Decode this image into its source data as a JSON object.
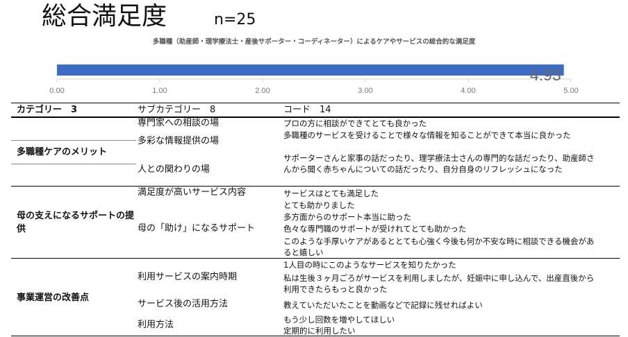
{
  "header": {
    "title": "総合満足度",
    "n_label": "n=25",
    "subtitle": "多職種（助産師・理学療法士・産後サポーター・コーディネーター）によるケアやサービスの総合的な満足度"
  },
  "colors": {
    "bar": "#3c6cc8",
    "value_label": "#666666"
  },
  "chart_data": {
    "type": "bar",
    "orientation": "horizontal",
    "categories": [
      ""
    ],
    "values": [
      4.93
    ],
    "value_labels": [
      "4.93"
    ],
    "xlim": [
      0,
      5
    ],
    "xticks": [
      "0.00",
      "1.00",
      "2.00",
      "3.00",
      "4.00",
      "5.00"
    ],
    "grid": false,
    "legend": "none"
  },
  "table": {
    "headers": {
      "category": "カテゴリー　3",
      "subcategory": "サブカテゴリー　8",
      "code": "コード　14"
    },
    "sections": [
      {
        "category": "多職種ケアのメリット",
        "subcategories": [
          "専門家への相談の場",
          "多彩な情報提供の場",
          "人との関わりの場"
        ],
        "codes": [
          "プロの方に相談ができてとても良かった",
          "多職種のサービスを受けることで様々な情報を知ることができて本当に良かった",
          "サポーターさんと家事の話だったり、理学療法士さんの専門的な話だったり、助産師さんから聞く赤ちゃんについての話だったり、自分自身のリフレッシュになった"
        ]
      },
      {
        "category": "母の支えになるサポートの提供",
        "subcategories": [
          "満足度が高いサービス内容",
          "母の「助け」になるサポート"
        ],
        "codes": [
          "サービスはとても満足した",
          "とても助かりました",
          "多方面からのサポート本当に助った",
          "色々な専門職のサポートが受けれてとても助かった",
          "このような手厚いケアがあるととても心強く今後も何か不安な時に相談できる機会があると嬉しい"
        ]
      },
      {
        "category": "事業運営の改善点",
        "subcategories": [
          "利用サービスの案内時期",
          "サービス後の活用方法",
          "利用方法"
        ],
        "codes": [
          "1人目の時にこのようなサービスを知りたかった",
          "私は生後３ヶ月ごろがサービスを利用しましたが、妊娠中に申し込んで、出産直後から利用できたらもっと良かった",
          "教えていただいたことを動画などで記録に残せればよい",
          "もう少し回数を増やしてほしい",
          "定期的に利用したい"
        ]
      }
    ]
  }
}
